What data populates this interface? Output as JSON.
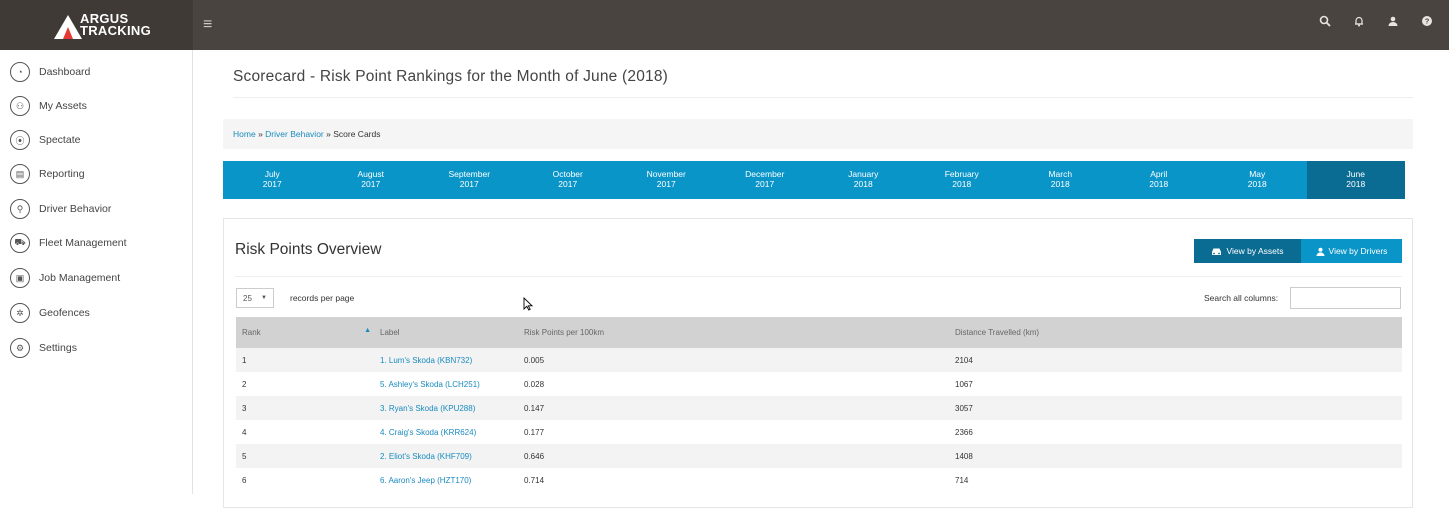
{
  "header": {
    "logo_line1": "ARGUS",
    "logo_line2": "TRACKING",
    "menu_icon": "hamburger-icon",
    "icons": [
      "search-icon",
      "bell-icon",
      "user-icon",
      "help-icon"
    ]
  },
  "sidebar": {
    "items": [
      {
        "label": "Dashboard",
        "icon": "speedometer-icon"
      },
      {
        "label": "My Assets",
        "icon": "assets-icon"
      },
      {
        "label": "Spectate",
        "icon": "map-pin-icon"
      },
      {
        "label": "Reporting",
        "icon": "report-icon"
      },
      {
        "label": "Driver Behavior",
        "icon": "driver-icon"
      },
      {
        "label": "Fleet Management",
        "icon": "fleet-icon"
      },
      {
        "label": "Job Management",
        "icon": "briefcase-icon"
      },
      {
        "label": "Geofences",
        "icon": "geofence-icon"
      },
      {
        "label": "Settings",
        "icon": "gear-icon"
      }
    ]
  },
  "page": {
    "title": "Scorecard - Risk Point Rankings for the Month of June (2018)",
    "breadcrumb": {
      "home": "Home",
      "sep": "»",
      "section": "Driver Behavior",
      "current": "Score Cards"
    }
  },
  "months": [
    {
      "month": "July",
      "year": "2017"
    },
    {
      "month": "August",
      "year": "2017"
    },
    {
      "month": "September",
      "year": "2017"
    },
    {
      "month": "October",
      "year": "2017"
    },
    {
      "month": "November",
      "year": "2017"
    },
    {
      "month": "December",
      "year": "2017"
    },
    {
      "month": "January",
      "year": "2018"
    },
    {
      "month": "February",
      "year": "2018"
    },
    {
      "month": "March",
      "year": "2018"
    },
    {
      "month": "April",
      "year": "2018"
    },
    {
      "month": "May",
      "year": "2018"
    },
    {
      "month": "June",
      "year": "2018",
      "active": true
    }
  ],
  "panel": {
    "title": "Risk Points Overview",
    "view_assets": "View by Assets",
    "view_drivers": "View by Drivers",
    "page_size": "25",
    "records_label": "records per page",
    "search_label": "Search all columns:",
    "search_value": ""
  },
  "table": {
    "columns": [
      "Rank",
      "Label",
      "Risk Points per 100km",
      "Distance Travelled (km)"
    ],
    "rows": [
      {
        "rank": "1",
        "label": "1. Lum's Skoda (KBN732)",
        "risk": "0.005",
        "distance": "2104"
      },
      {
        "rank": "2",
        "label": "5. Ashley's Skoda (LCH251)",
        "risk": "0.028",
        "distance": "1067"
      },
      {
        "rank": "3",
        "label": "3. Ryan's Skoda (KPU288)",
        "risk": "0.147",
        "distance": "3057"
      },
      {
        "rank": "4",
        "label": "4. Craig's Skoda (KRR624)",
        "risk": "0.177",
        "distance": "2366"
      },
      {
        "rank": "5",
        "label": "2. Eliot's Skoda (KHF709)",
        "risk": "0.646",
        "distance": "1408"
      },
      {
        "rank": "6",
        "label": "6. Aaron's Jeep (HZT170)",
        "risk": "0.714",
        "distance": "714"
      }
    ]
  },
  "colors": {
    "topbar": "#4a4440",
    "accent": "#0a95c9",
    "accent_dark": "#0b6c93",
    "link": "#1a8bbf"
  }
}
